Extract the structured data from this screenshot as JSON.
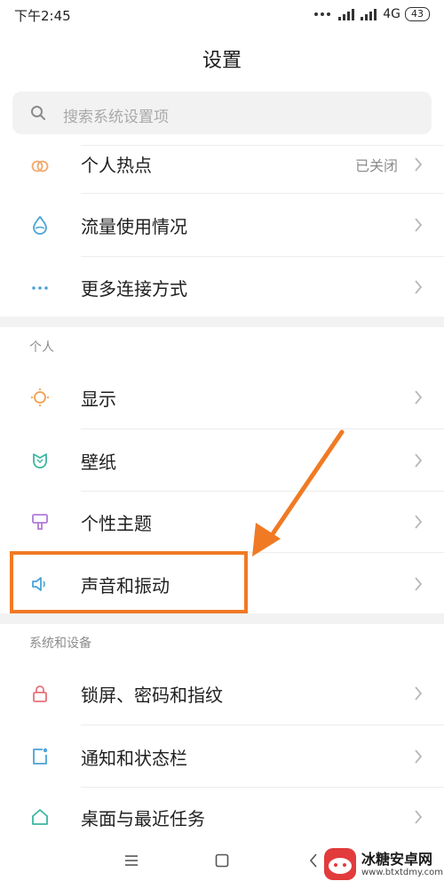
{
  "status_bar": {
    "time": "下午2:45",
    "network": "4G",
    "battery": "43"
  },
  "header": {
    "title": "设置"
  },
  "search": {
    "placeholder": "搜索系统设置项"
  },
  "rows_top": [
    {
      "label": "个人热点",
      "value": "已关闭",
      "icon": "hotspot-icon",
      "color": "#f0a86b"
    },
    {
      "label": "流量使用情况",
      "value": "",
      "icon": "data-usage-icon",
      "color": "#4aa3d8"
    },
    {
      "label": "更多连接方式",
      "value": "",
      "icon": "more-connections-icon",
      "color": "#4aa3d8"
    }
  ],
  "section_personal": {
    "title": "个人",
    "items": [
      {
        "label": "显示",
        "icon": "display-icon",
        "color": "#f0a050"
      },
      {
        "label": "壁纸",
        "icon": "wallpaper-icon",
        "color": "#3bb7a0"
      },
      {
        "label": "个性主题",
        "icon": "theme-icon",
        "color": "#b07ad8"
      },
      {
        "label": "声音和振动",
        "icon": "sound-icon",
        "color": "#4aa3d8"
      }
    ]
  },
  "section_system": {
    "title": "系统和设备",
    "items": [
      {
        "label": "锁屏、密码和指纹",
        "icon": "lock-icon",
        "color": "#e8707a"
      },
      {
        "label": "通知和状态栏",
        "icon": "notification-icon",
        "color": "#4aa3d8"
      },
      {
        "label": "桌面与最近任务",
        "icon": "home-icon",
        "color": "#3bb7a0"
      }
    ]
  },
  "annotation": {
    "color": "#f07a24"
  },
  "watermark": {
    "name": "冰糖安卓网",
    "url": "www.btxtdmy.com"
  }
}
